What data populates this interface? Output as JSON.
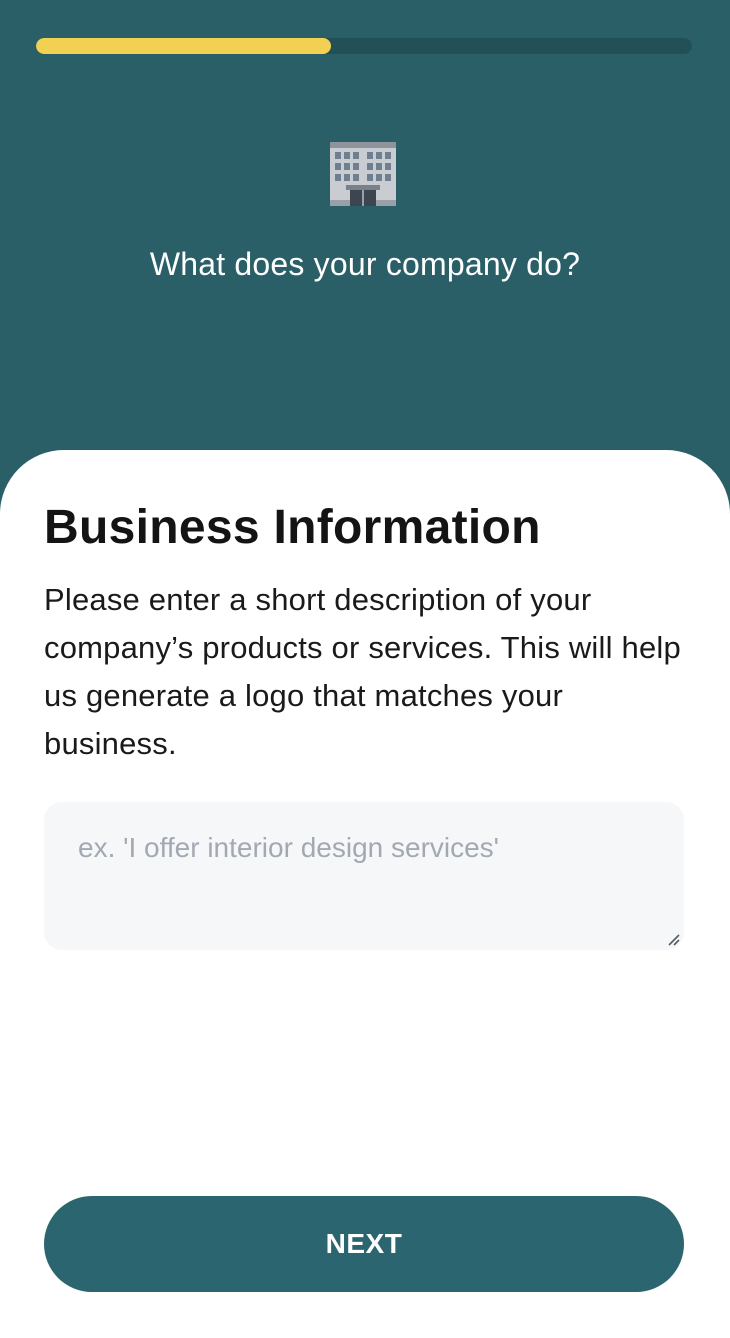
{
  "header": {
    "progress_fraction": 0.45,
    "icon": "office-building-icon",
    "question": "What does your company do?",
    "colors": {
      "background": "#2a5f68",
      "progress_fill": "#f2d152",
      "progress_track": "#234f56"
    }
  },
  "card": {
    "title": "Business Information",
    "description": "Please enter a short description of your company’s products or services. This will help us generate a logo that matches your business.",
    "input": {
      "placeholder": "ex. 'I offer interior design services'",
      "value": ""
    },
    "next_label": "NEXT",
    "colors": {
      "button": "#2b6570",
      "input_background": "#f6f7f9"
    }
  }
}
